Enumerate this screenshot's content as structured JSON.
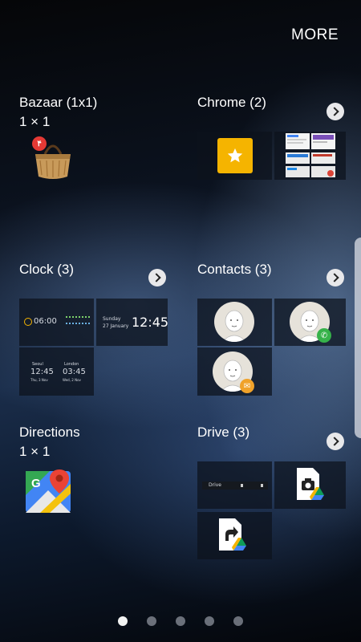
{
  "header": {
    "more_label": "MORE"
  },
  "widgets": {
    "bazaar": {
      "title": "Bazaar (1x1)",
      "size": "1 × 1",
      "badge": "۴"
    },
    "chrome": {
      "title": "Chrome (2)"
    },
    "clock": {
      "title": "Clock (3)",
      "alarm_time": "06:00",
      "day_label": "Sunday",
      "date_label": "27 January",
      "big_time": "12:45",
      "city1": "Seoul",
      "city1_time": "12:45",
      "city1_date": "Thu, 3 Nov",
      "city2": "London",
      "city2_time": "03:45",
      "city2_date": "Wed, 2 Nov"
    },
    "contacts": {
      "title": "Contacts (3)"
    },
    "directions": {
      "title": "Directions",
      "size": "1 × 1"
    },
    "drive": {
      "title": "Drive (3)",
      "bar_label": "Drive"
    }
  },
  "pagination": {
    "pages": 5,
    "active": 1
  },
  "icons": [
    "chevron-right-icon",
    "star-icon",
    "alarm-icon",
    "phone-icon",
    "email-icon",
    "camera-icon",
    "drive-logo-icon",
    "maps-icon",
    "bazaar-bag-icon"
  ],
  "colors": {
    "accent_yellow": "#f5b400",
    "phone_green": "#36b24a",
    "email_orange": "#f0a22a",
    "badge_red": "#e53935"
  }
}
